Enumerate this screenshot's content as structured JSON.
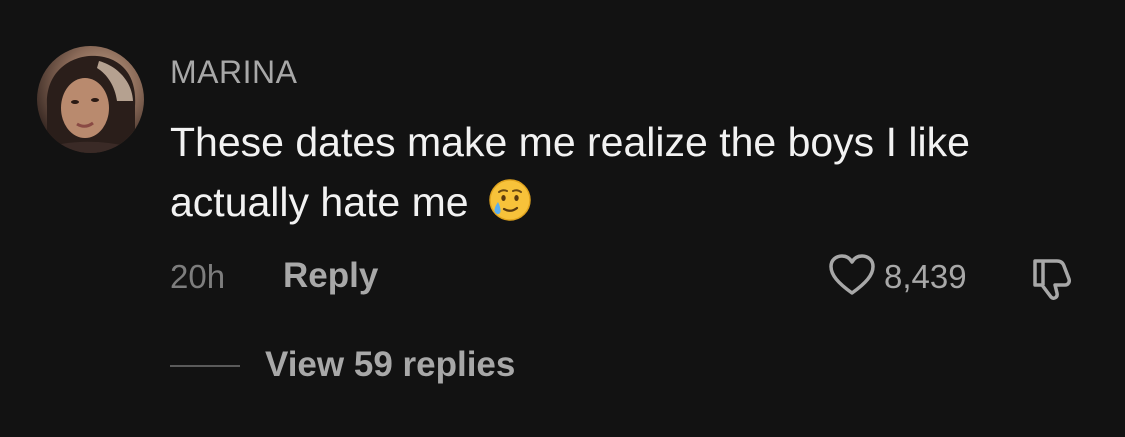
{
  "comment": {
    "username": "MARINA",
    "text": "These dates make me realize the boys I like actually hate me",
    "emoji": "crying-face-with-smile-emoji",
    "timestamp": "20h",
    "reply_label": "Reply",
    "like_count": "8,439",
    "view_replies_label": "View 59 replies"
  },
  "colors": {
    "background": "#121212",
    "username": "#a8a8a8",
    "text": "#f2f2f2",
    "muted": "#7d7d7d",
    "action": "#a8a8a8"
  },
  "icons": {
    "like": "heart-outline-icon",
    "dislike": "thumbs-down-icon"
  }
}
